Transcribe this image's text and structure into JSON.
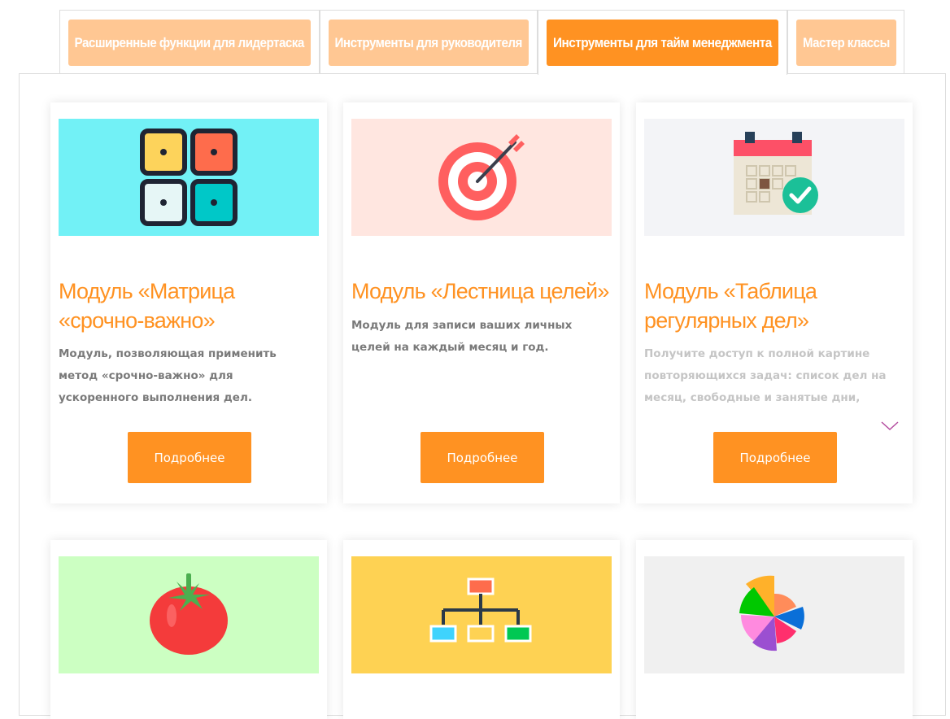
{
  "tabs": [
    {
      "label": "Расширенные функции для лидертаска",
      "active": false
    },
    {
      "label": "Инструменты для руководителя",
      "active": false
    },
    {
      "label": "Инструменты для тайм менеджмента",
      "active": true
    },
    {
      "label": "Мастер классы",
      "active": false
    }
  ],
  "cards": [
    {
      "icon": "matrix-grid-icon",
      "image_bg": "#72f1f6",
      "title": "Модуль «Матрица «срочно-важно»",
      "description": "Модуль, позволяющая применить метод «срочно-важно» для ускоренного выполнения дел.",
      "button": "Подробнее"
    },
    {
      "icon": "target-icon",
      "image_bg": "#ffe6e0",
      "title": "Модуль «Лестница целей»",
      "description": "Модуль для записи ваших личных целей на каждый месяц и год.",
      "button": "Подробнее"
    },
    {
      "icon": "calendar-check-icon",
      "image_bg": "#f3f4f7",
      "title": "Модуль «Таблица регулярных дел»",
      "description": "Получите доступ к полной картине повторяющихся задач: список дел на месяц, свободные и занятые дни,",
      "button": "Подробнее"
    },
    {
      "icon": "tomato-icon",
      "image_bg": "#ccffc2"
    },
    {
      "icon": "org-chart-icon",
      "image_bg": "#fed253"
    },
    {
      "icon": "pie-chart-icon",
      "image_bg": "#f0f0f0"
    }
  ],
  "colors": {
    "accent": "#ff9222",
    "tab_inactive": "#ffc793",
    "text_muted": "#7a7a7a"
  }
}
